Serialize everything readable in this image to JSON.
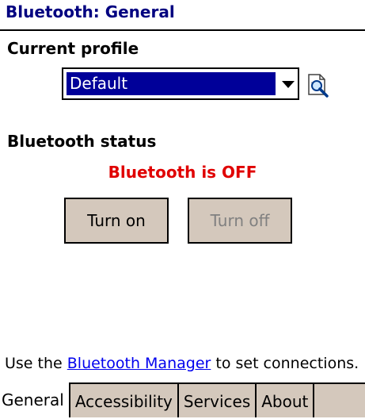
{
  "window": {
    "title": "Bluetooth: General"
  },
  "profile": {
    "heading": "Current profile",
    "selected": "Default"
  },
  "status": {
    "heading": "Bluetooth status",
    "text": "Bluetooth is OFF",
    "text_color": "#e00000"
  },
  "buttons": {
    "turn_on": "Turn on",
    "turn_off": "Turn off"
  },
  "footer": {
    "prefix": "Use the ",
    "link": "Bluetooth Manager",
    "suffix": " to set connections."
  },
  "tabs": [
    {
      "label": "General",
      "active": true
    },
    {
      "label": "Accessibility",
      "active": false
    },
    {
      "label": "Services",
      "active": false
    },
    {
      "label": "About",
      "active": false
    }
  ],
  "icons": {
    "dropdown": "chevron-down-icon",
    "edit_profile": "edit-profile-icon"
  },
  "colors": {
    "title": "#000080",
    "selection": "#000099",
    "button_face": "#d4c8bc",
    "link": "#0000ee"
  }
}
